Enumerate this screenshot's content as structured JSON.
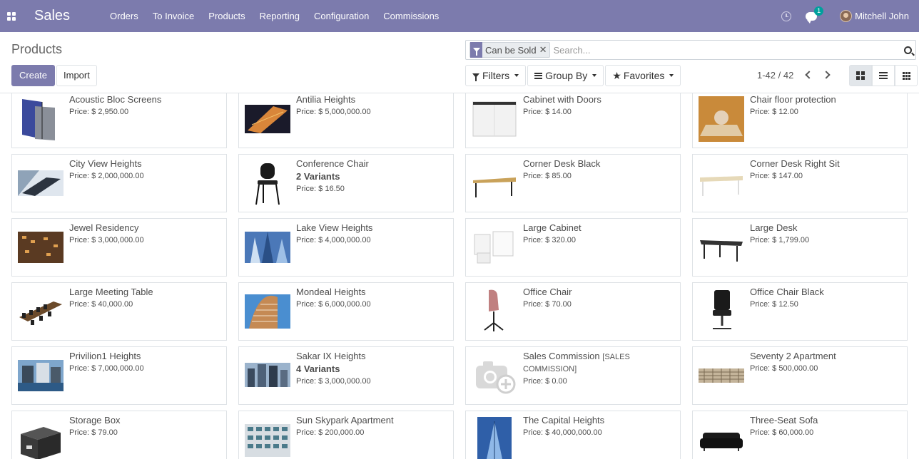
{
  "navbar": {
    "app_name": "Sales",
    "menu": [
      "Orders",
      "To Invoice",
      "Products",
      "Reporting",
      "Configuration",
      "Commissions"
    ],
    "chat_count": "1",
    "user_name": "Mitchell John"
  },
  "control": {
    "title": "Products",
    "create_label": "Create",
    "import_label": "Import",
    "facet_label": "Can be Sold",
    "search_placeholder": "Search...",
    "filters_label": "Filters",
    "groupby_label": "Group By",
    "favorites_label": "Favorites",
    "pager": "1-42 / 42"
  },
  "products": [
    {
      "name": "Acoustic Bloc Screens",
      "price": "Price: $ 2,950.00",
      "thumb": "acoustic-screens"
    },
    {
      "name": "Antilia Heights",
      "price": "Price: $ 5,000,000.00",
      "thumb": "building-night"
    },
    {
      "name": "Cabinet with Doors",
      "price": "Price: $ 14.00",
      "thumb": "cabinet-white"
    },
    {
      "name": "Chair floor protection",
      "price": "Price: $ 12.00",
      "thumb": "floor-mat"
    },
    {
      "name": "City View Heights",
      "price": "Price: $ 2,000,000.00",
      "thumb": "building-glass"
    },
    {
      "name": "Conference Chair",
      "variants": "2 Variants",
      "price": "Price: $ 16.50",
      "thumb": "chair-black"
    },
    {
      "name": "Corner Desk Black",
      "price": "Price: $ 85.00",
      "thumb": "desk-wood"
    },
    {
      "name": "Corner Desk Right Sit",
      "price": "Price: $ 147.00",
      "thumb": "desk-light"
    },
    {
      "name": "Jewel Residency",
      "price": "Price: $ 3,000,000.00",
      "thumb": "building-brown"
    },
    {
      "name": "Lake View Heights",
      "price": "Price: $ 4,000,000.00",
      "thumb": "building-sky"
    },
    {
      "name": "Large Cabinet",
      "price": "Price: $ 320.00",
      "thumb": "cabinet-large"
    },
    {
      "name": "Large Desk",
      "price": "Price: $ 1,799.00",
      "thumb": "desk-dark"
    },
    {
      "name": "Large Meeting Table",
      "price": "Price: $ 40,000.00",
      "thumb": "meeting-table"
    },
    {
      "name": "Mondeal Heights",
      "price": "Price: $ 6,000,000.00",
      "thumb": "building-round"
    },
    {
      "name": "Office Chair",
      "price": "Price: $ 70.00",
      "thumb": "chair-pink"
    },
    {
      "name": "Office Chair Black",
      "price": "Price: $ 12.50",
      "thumb": "chair-office"
    },
    {
      "name": "Privilion1 Heights",
      "price": "Price: $ 7,000,000.00",
      "thumb": "building-water"
    },
    {
      "name": "Sakar IX Heights",
      "variants": "4 Variants",
      "price": "Price: $ 3,000,000.00",
      "thumb": "building-towers"
    },
    {
      "name": "Sales Commission",
      "ref": "[SALES COMMISSION]",
      "price": "Price: $ 0.00",
      "thumb": "camera-placeholder"
    },
    {
      "name": "Seventy 2 Apartment",
      "price": "Price: $ 500,000.00",
      "thumb": "building-facade"
    },
    {
      "name": "Storage Box",
      "price": "Price: $ 79.00",
      "thumb": "storage-box"
    },
    {
      "name": "Sun Skypark Apartment",
      "price": "Price: $ 200,000.00",
      "thumb": "building-balconies"
    },
    {
      "name": "The Capital Heights",
      "price": "Price: $ 40,000,000.00",
      "thumb": "building-blue"
    },
    {
      "name": "Three-Seat Sofa",
      "price": "Price: $ 60,000.00",
      "thumb": "sofa-black"
    }
  ]
}
